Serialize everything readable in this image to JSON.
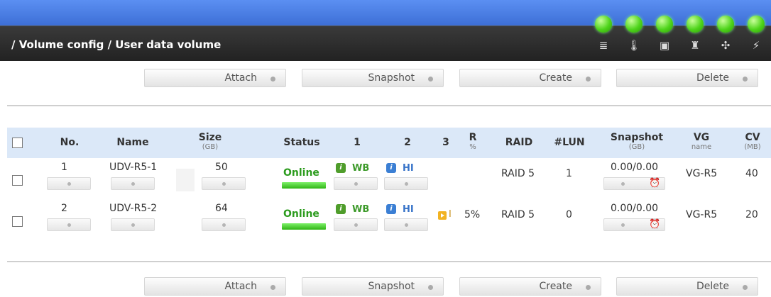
{
  "header": {
    "breadcrumb": "/ Volume config / User data volume",
    "status_icons": [
      "disk-stack-icon",
      "temperature-icon",
      "power-supply-icon",
      "ups-icon",
      "fan-icon",
      "voltage-icon"
    ]
  },
  "actions": {
    "attach": "Attach",
    "snapshot": "Snapshot",
    "create": "Create",
    "delete": "Delete"
  },
  "table": {
    "columns": {
      "no": "No.",
      "name": "Name",
      "size": "Size",
      "size_unit": "(GB)",
      "status": "Status",
      "c1": "1",
      "c2": "2",
      "c3": "3",
      "r": "R",
      "r_unit": "%",
      "raid": "RAID",
      "lun": "#LUN",
      "snapshot": "Snapshot",
      "snapshot_unit": "(GB)",
      "vg": "VG",
      "vg_sub": "name",
      "cv": "CV",
      "cv_unit": "(MB)"
    },
    "rows": [
      {
        "no": "1",
        "name": "UDV-R5-1",
        "size": "50",
        "status": "Online",
        "wb": "WB",
        "hi": "HI",
        "c3": "",
        "r": "",
        "raid": "RAID 5",
        "lun": "1",
        "snapshot": "0.00/0.00",
        "vg": "VG-R5",
        "cv": "40"
      },
      {
        "no": "2",
        "name": "UDV-R5-2",
        "size": "64",
        "status": "Online",
        "wb": "WB",
        "hi": "HI",
        "c3": "I",
        "r": "5%",
        "raid": "RAID 5",
        "lun": "0",
        "snapshot": "0.00/0.00",
        "vg": "VG-R5",
        "cv": "20"
      }
    ]
  },
  "colors": {
    "header_blue": "#4a7ee6",
    "header_dark": "#2b2b2b",
    "led_green": "#4ed41a",
    "online_green": "#2d9c1f",
    "table_header_bg": "#dbe8f8"
  }
}
